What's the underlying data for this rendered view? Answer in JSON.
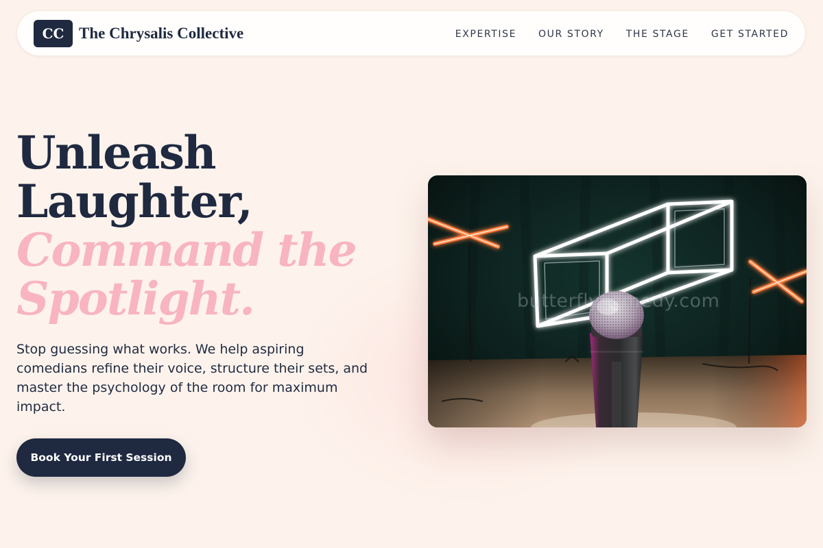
{
  "brand": {
    "logo_initials": "CC",
    "name": "The Chrysalis Collective"
  },
  "nav": {
    "items": [
      {
        "label": "EXPERTISE"
      },
      {
        "label": "OUR STORY"
      },
      {
        "label": "THE STAGE"
      },
      {
        "label": "GET STARTED"
      }
    ]
  },
  "hero": {
    "headline_line1": "Unleash",
    "headline_line2": "Laughter,",
    "headline_accent_line1": "Command the",
    "headline_accent_line2": "Spotlight.",
    "description": "Stop guessing what works. We help aspiring comedians refine their voice, structure their sets, and master the psychology of the room for maximum impact.",
    "cta_label": "Book Your First Session",
    "image_watermark": "butterflycomedy.com"
  },
  "colors": {
    "background": "#fdf3ec",
    "navy": "#1f2940",
    "accent_pink": "#f8b4c1",
    "neon_orange": "#ff6a2b"
  }
}
